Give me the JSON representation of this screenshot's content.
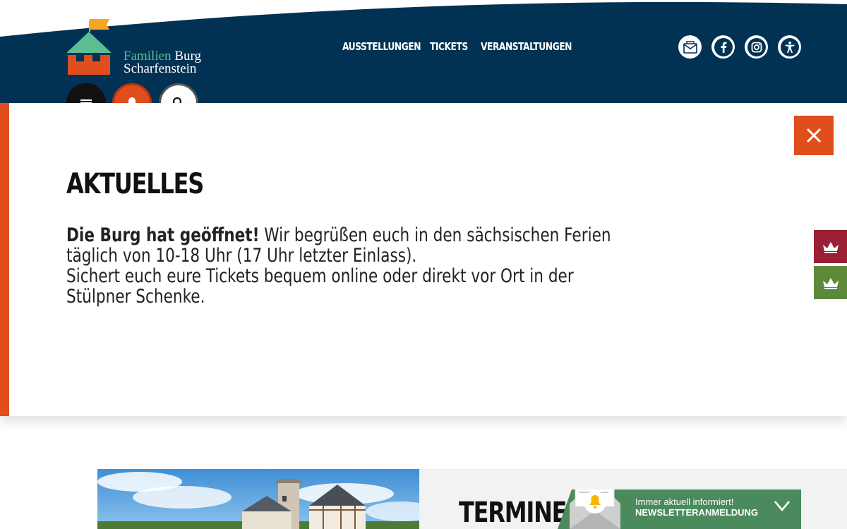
{
  "header": {
    "logo": {
      "line1_part1": "Familien",
      "line1_part2": "Burg",
      "line2": "Scharfenstein"
    },
    "nav": [
      "AUSSTELLUNGEN",
      "TICKETS",
      "VERANSTALTUNGEN"
    ],
    "social_icons": [
      "newsletter-mail-icon",
      "facebook-icon",
      "instagram-icon",
      "accessibility-icon"
    ],
    "action_icons": [
      "menu-icon",
      "bell-icon",
      "search-icon"
    ],
    "colors": {
      "navy": "#023253",
      "orange": "#e04e1d",
      "green": "#5bbf93"
    }
  },
  "notice": {
    "title": "AKTUELLES",
    "bold": "Die Burg hat geöffnet!",
    "line1": " Wir begrüßen euch in den sächsischen Ferien täglich von 10-18 Uhr (17 Uhr letzter Einlass).",
    "line2": "Sichert euch eure Tickets bequem online oder direkt vor Ort in der Stülpner Schenke.",
    "close_icon": "close-icon",
    "side_tabs": [
      "crown-icon",
      "crown-icon"
    ]
  },
  "events": {
    "title": "TERMINE &"
  },
  "newsletter": {
    "line1": "Immer aktuell informiert!",
    "line2": "NEWSLETTERANMELDUNG",
    "icon": "chevron-down-icon"
  }
}
